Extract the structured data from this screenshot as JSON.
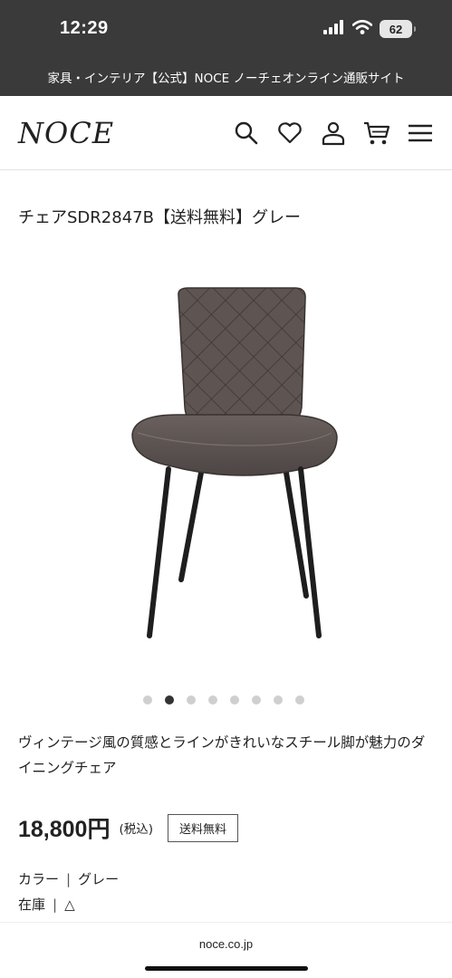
{
  "status_bar": {
    "time": "12:29",
    "battery": "62"
  },
  "site_bar": {
    "text": "家具・インテリア【公式】NOCE ノーチェオンライン通販サイト"
  },
  "header": {
    "logo": "NOCE",
    "icons": [
      "search-icon",
      "heart-icon",
      "user-icon",
      "cart-icon",
      "menu-icon"
    ]
  },
  "product": {
    "title": "チェアSDR2847B【送料無料】グレー",
    "gallery": {
      "slide_count": 8,
      "active_index": 1
    },
    "description": "ヴィンテージ風の質感とラインがきれいなスチール脚が魅力のダイニングチェア",
    "price": "18,800円",
    "tax_note": "(税込)",
    "shipping_badge": "送料無料",
    "color_label": "カラー",
    "color_value": "グレー",
    "stock_label": "在庫",
    "stock_value": "△"
  },
  "browser": {
    "url": "noce.co.jp"
  },
  "colors": {
    "top_bar": "#3a3a3a",
    "chair_fabric": "#5e5552",
    "chair_legs": "#1e1e1e",
    "dot_active": "#333333",
    "dot_inactive": "#cfcfcf"
  }
}
